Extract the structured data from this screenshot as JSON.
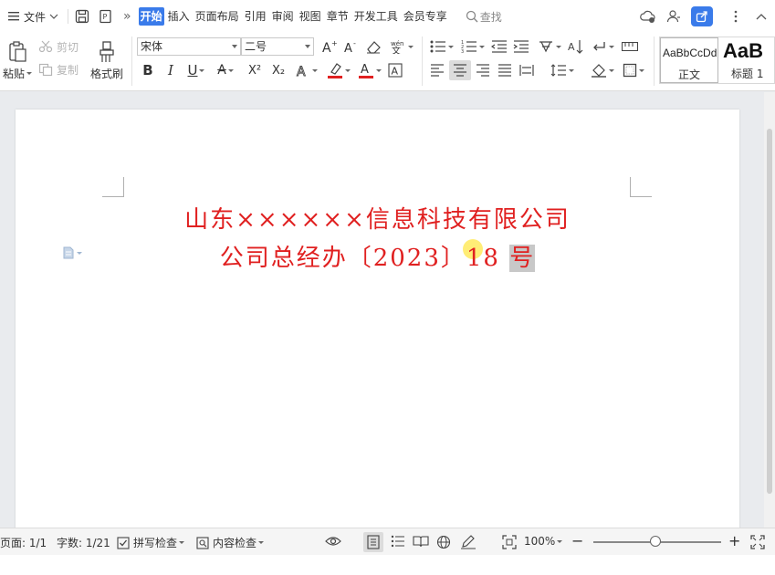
{
  "menubar": {
    "menu_label": "文件",
    "tabs": [
      {
        "label": "开始",
        "active": true
      },
      {
        "label": "插入",
        "active": false
      },
      {
        "label": "页面布局",
        "active": false
      },
      {
        "label": "引用",
        "active": false
      },
      {
        "label": "审阅",
        "active": false
      },
      {
        "label": "视图",
        "active": false
      },
      {
        "label": "章节",
        "active": false
      },
      {
        "label": "开发工具",
        "active": false
      },
      {
        "label": "会员专享",
        "active": false
      }
    ],
    "search_label": "查找",
    "more_glyph": "»"
  },
  "ribbon": {
    "paste_label": "粘贴",
    "cut_label": "剪切",
    "copy_label": "复制",
    "format_painter_label": "格式刷",
    "font_name": "宋体",
    "font_size": "二号",
    "bold": "B",
    "italic": "I",
    "underline": "U",
    "strikethrough_glyph": "A",
    "superscript": "X²",
    "subscript": "X₂",
    "styles": [
      {
        "preview": "AaBbCcDd",
        "name": "正文"
      },
      {
        "preview": "AaB",
        "name": "标题 1"
      }
    ]
  },
  "document": {
    "title_line1": "山东××××××信息科技有限公司",
    "title_line2_prefix": "公司总经办〔2023〕18 ",
    "title_line2_highlight": "号",
    "text_color": "#e02020"
  },
  "statusbar": {
    "page": "页面: 1/1",
    "word_count": "字数: 1/21",
    "spell_check": "拼写检查",
    "content_check": "内容检查",
    "zoom": "100%",
    "zoom_level_percent": 100
  },
  "colors": {
    "accent": "#3a7bea",
    "highlight_bar": "#e02020",
    "font_color_bar": "#e02020"
  }
}
